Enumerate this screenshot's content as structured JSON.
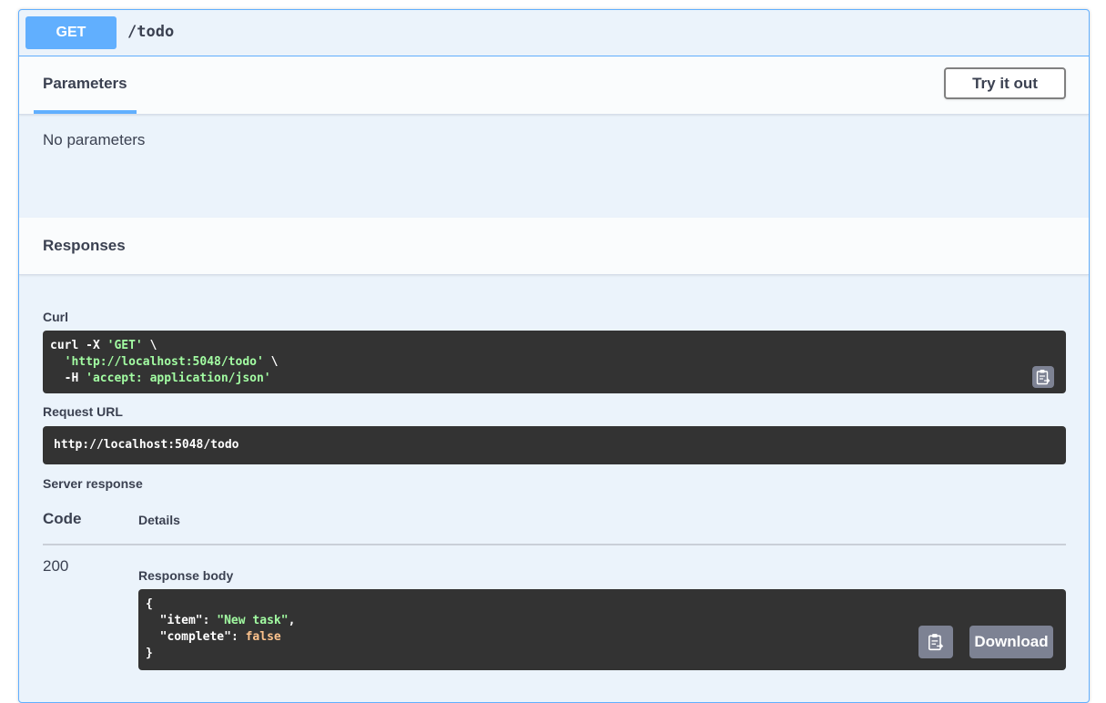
{
  "operation": {
    "method": "GET",
    "path": "/todo"
  },
  "parameters": {
    "tab_label": "Parameters",
    "try_button": "Try it out",
    "empty_text": "No parameters"
  },
  "responses": {
    "title": "Responses",
    "curl_label": "Curl",
    "curl_line1_cmd": "curl -X ",
    "curl_line1_method": "'GET'",
    "curl_line1_tail": " \\",
    "curl_line2_indent": "  ",
    "curl_line2_url": "'http://localhost:5048/todo'",
    "curl_line2_tail": " \\",
    "curl_line3_flag": "  -H ",
    "curl_line3_header": "'accept: application/json'",
    "request_url_label": "Request URL",
    "request_url": "http://localhost:5048/todo",
    "server_response_label": "Server response",
    "col_code": "Code",
    "col_details": "Details",
    "status_code": "200",
    "response_body_label": "Response body",
    "body_open": "{",
    "body_key1": "\"item\"",
    "body_val1": "\"New task\"",
    "body_key2": "\"complete\"",
    "body_val2": "false",
    "body_close": "}",
    "download_label": "Download"
  },
  "colors": {
    "method_get": "#61affe",
    "code_bg": "#333333",
    "string": "#a2fca2",
    "boolean": "#fcc28c",
    "button_gray": "#7d8293"
  },
  "icons": {
    "copy": "clipboard-icon"
  }
}
